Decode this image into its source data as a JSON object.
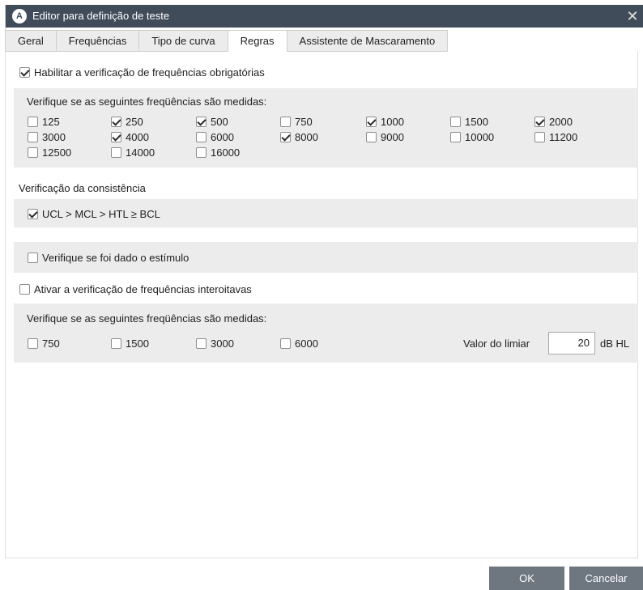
{
  "window": {
    "title": "Editor para definição de teste",
    "app_icon_letter": "A",
    "close_glyph": "✕"
  },
  "tabs": [
    {
      "label": "Geral"
    },
    {
      "label": "Frequências"
    },
    {
      "label": "Tipo de curva"
    },
    {
      "label": "Regras",
      "active": true
    },
    {
      "label": "Assistente de Mascaramento"
    }
  ],
  "mandatory": {
    "enable_label": "Habilitar a verificação de frequências obrigatórias",
    "enabled": true,
    "panel_heading": "Verifique se as seguintes freqüências são medidas:",
    "frequencies": [
      {
        "label": "125",
        "checked": false
      },
      {
        "label": "250",
        "checked": true
      },
      {
        "label": "500",
        "checked": true
      },
      {
        "label": "750",
        "checked": false
      },
      {
        "label": "1000",
        "checked": true
      },
      {
        "label": "1500",
        "checked": false
      },
      {
        "label": "2000",
        "checked": true
      },
      {
        "label": "3000",
        "checked": false
      },
      {
        "label": "4000",
        "checked": true
      },
      {
        "label": "6000",
        "checked": false
      },
      {
        "label": "8000",
        "checked": true
      },
      {
        "label": "9000",
        "checked": false
      },
      {
        "label": "10000",
        "checked": false
      },
      {
        "label": "11200",
        "checked": false
      },
      {
        "label": "12500",
        "checked": false
      },
      {
        "label": "14000",
        "checked": false
      },
      {
        "label": "16000",
        "checked": false
      }
    ]
  },
  "consistency": {
    "heading": "Verificação da consistência",
    "rule_label": "UCL > MCL > HTL ≥ BCL",
    "rule_checked": true
  },
  "stimulus": {
    "label": "Verifique se foi dado o estímulo",
    "checked": false
  },
  "interoctave": {
    "enable_label": "Ativar a verificação de frequências interoitavas",
    "enabled": false,
    "panel_heading": "Verifique se as seguintes freqüências são medidas:",
    "frequencies": [
      {
        "label": "750",
        "checked": false
      },
      {
        "label": "1500",
        "checked": false
      },
      {
        "label": "3000",
        "checked": false
      },
      {
        "label": "6000",
        "checked": false
      }
    ],
    "threshold_label": "Valor do limiar",
    "threshold_value": "20",
    "threshold_unit": "dB HL"
  },
  "buttons": {
    "ok": "OK",
    "cancel": "Cancelar"
  }
}
